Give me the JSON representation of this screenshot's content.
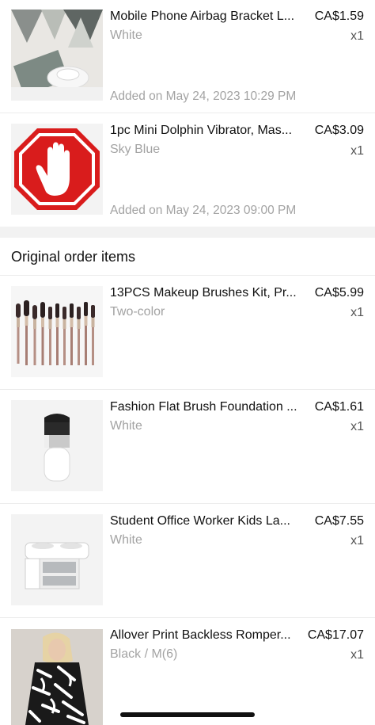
{
  "cart_items": [
    {
      "name": "Mobile Phone Airbag Bracket L...",
      "price": "CA$1.59",
      "variant": "White",
      "qty": "x1",
      "added": "Added on May 24, 2023 10:29 PM"
    },
    {
      "name": "1pc Mini Dolphin Vibrator, Mas...",
      "price": "CA$3.09",
      "variant": "Sky Blue",
      "qty": "x1",
      "added": "Added on May 24, 2023 09:00 PM"
    }
  ],
  "section": {
    "title": "Original order items"
  },
  "order_items": [
    {
      "name": "13PCS Makeup Brushes Kit, Pr...",
      "price": "CA$5.99",
      "variant": "Two-color",
      "qty": "x1"
    },
    {
      "name": "Fashion Flat Brush Foundation ...",
      "price": "CA$1.61",
      "variant": "White",
      "qty": "x1"
    },
    {
      "name": "Student Office Worker Kids La...",
      "price": "CA$7.55",
      "variant": "White",
      "qty": "x1"
    },
    {
      "name": "Allover Print Backless Romper...",
      "price": "CA$17.07",
      "variant": "Black / M(6)",
      "qty": "x1"
    }
  ],
  "colors": {
    "stop_sign_red": "#d91c1c",
    "muted_text": "#a3a3a3",
    "divider": "#ececec"
  },
  "icons": {
    "stop_hand": "stop-hand-icon"
  }
}
